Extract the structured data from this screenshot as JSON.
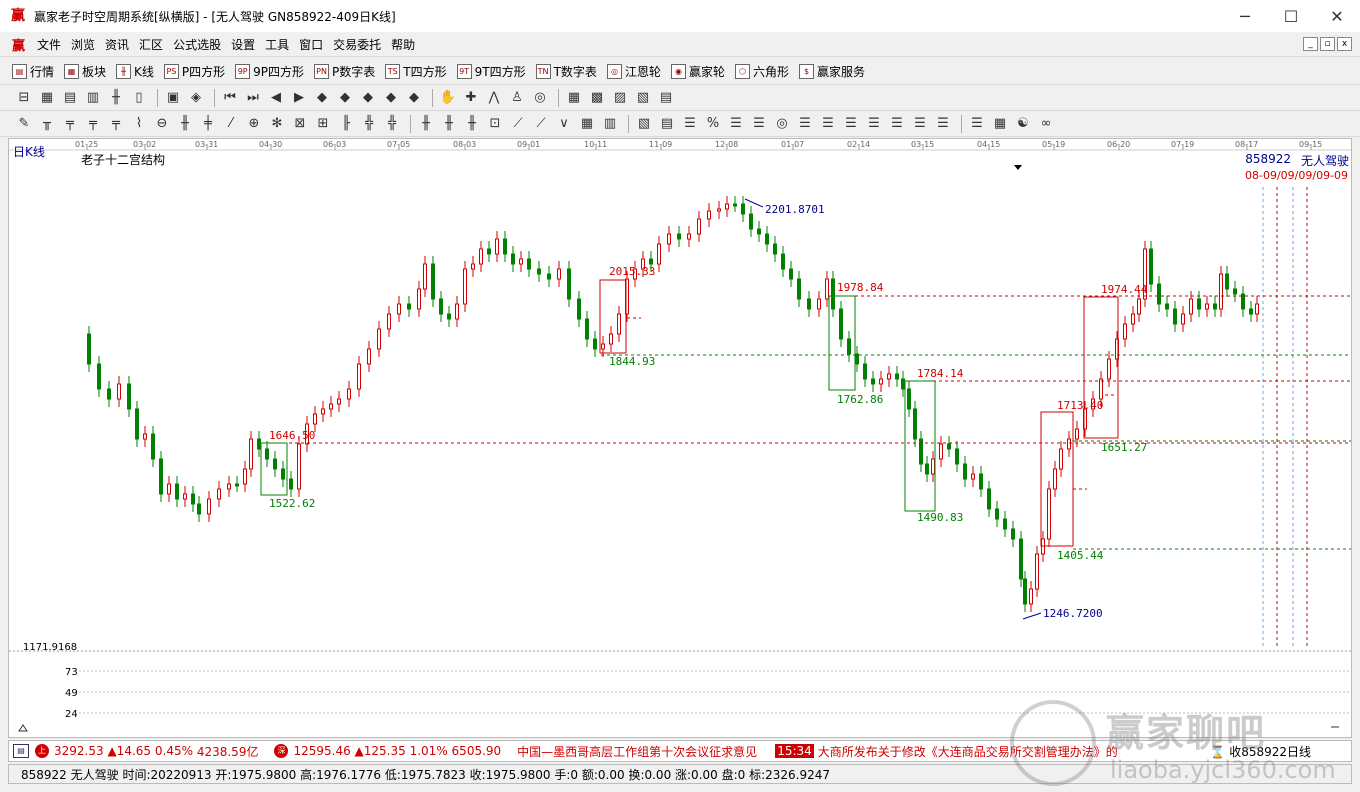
{
  "window": {
    "title": "赢家老子时空周期系统[纵横版] - [无人驾驶  GN858922-409日K线]",
    "controls": {
      "minimize": "─",
      "maximize": "☐",
      "close": "✕"
    }
  },
  "menu": {
    "items": [
      "文件",
      "浏览",
      "资讯",
      "汇区",
      "公式选股",
      "设置",
      "工具",
      "窗口",
      "交易委托",
      "帮助"
    ],
    "mdi_controls": [
      "_",
      "▫",
      "x"
    ]
  },
  "toolbar1": {
    "items": [
      {
        "icon": "grid-icon",
        "glyph": "▤",
        "label": "行情"
      },
      {
        "icon": "blocks-icon",
        "glyph": "▦",
        "label": "板块"
      },
      {
        "icon": "candlestick-icon",
        "glyph": "╫",
        "label": "K线"
      },
      {
        "icon": "ps-icon",
        "glyph": "PS",
        "label": "P四方形"
      },
      {
        "icon": "9p-icon",
        "glyph": "9P",
        "label": "9P四方形"
      },
      {
        "icon": "pn-icon",
        "glyph": "PN",
        "label": "P数字表"
      },
      {
        "icon": "ts-icon",
        "glyph": "TS",
        "label": "T四方形"
      },
      {
        "icon": "9t-icon",
        "glyph": "9T",
        "label": "9T四方形"
      },
      {
        "icon": "tn-icon",
        "glyph": "TN",
        "label": "T数字表"
      },
      {
        "icon": "wheel-icon",
        "glyph": "◎",
        "label": "江恩轮"
      },
      {
        "icon": "win-wheel-icon",
        "glyph": "◉",
        "label": "赢家轮"
      },
      {
        "icon": "hexagon-icon",
        "glyph": "⬡",
        "label": "六角形"
      },
      {
        "icon": "dollar-icon",
        "glyph": "$",
        "label": "赢家服务"
      }
    ]
  },
  "chart": {
    "period_label": "日K线",
    "indicator_name": "老子十二宫结构",
    "stock_code": "858922",
    "stock_name": "无人驾驶",
    "future_dates_label": "08-09/09/09/09-09",
    "date_ticks": [
      "01-25",
      "03-02",
      "03-31",
      "04-30",
      "06-03",
      "07-05",
      "08-03",
      "09-01",
      "10-11",
      "11-09",
      "12-08",
      "01-07",
      "02-14",
      "03-15",
      "04-15",
      "05-19",
      "06-20",
      "07-19",
      "08-17",
      "09-15"
    ],
    "y_min_label": "1171.9168",
    "volume_ticks": [
      "73",
      "49",
      "24"
    ],
    "annotations": [
      {
        "text": "2201.8701",
        "color": "#00008b"
      },
      {
        "text": "2015.33",
        "color": "#d00000"
      },
      {
        "text": "1844.93",
        "color": "#008000"
      },
      {
        "text": "1978.84",
        "color": "#d00000"
      },
      {
        "text": "1762.86",
        "color": "#008000"
      },
      {
        "text": "1784.14",
        "color": "#d00000"
      },
      {
        "text": "1646.50",
        "color": "#d00000"
      },
      {
        "text": "1522.62",
        "color": "#008000"
      },
      {
        "text": "1490.83",
        "color": "#008000"
      },
      {
        "text": "1713.40",
        "color": "#d00000"
      },
      {
        "text": "1651.27",
        "color": "#008000"
      },
      {
        "text": "1974.44",
        "color": "#d00000"
      },
      {
        "text": "1405.44",
        "color": "#008000"
      },
      {
        "text": "1246.7200",
        "color": "#00008b"
      }
    ],
    "colors": {
      "up": "#d00000",
      "down": "#008000",
      "accent": "#00008b"
    }
  },
  "status1": {
    "index1": {
      "value": "3292.53",
      "change": "▲14.65",
      "pct": "0.45%",
      "amount": "4238.59亿"
    },
    "index2": {
      "value": "12595.46",
      "change": "▲125.35",
      "pct": "1.01%",
      "amount": "6505.90"
    },
    "news1": "中国—墨西哥高层工作组第十次会议征求意见",
    "news_time": "15:34",
    "news2": "大商所发布关于修改《大连商品交易所交割管理办法》的",
    "right_text": "收858922日线"
  },
  "status2": {
    "text": "858922 无人驾驶 时间:20220913 开:1975.9800 高:1976.1776 低:1975.7823 收:1975.9800 手:0 额:0.00 换:0.00 涨:0.00 盘:0 标:2326.9247"
  },
  "watermark": {
    "title": "赢家聊吧",
    "url": "liaoba.yjcl360.com"
  }
}
